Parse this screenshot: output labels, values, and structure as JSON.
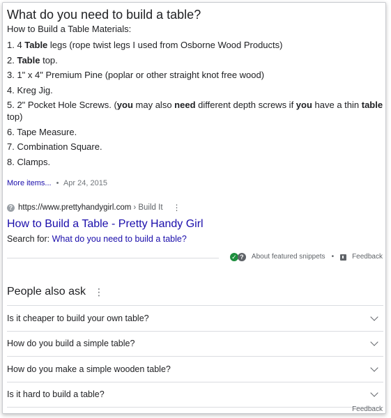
{
  "snippet": {
    "question": "What do you need to build a table?",
    "subheading": "How to Build a Table Materials:",
    "items": [
      [
        {
          "t": "1. 4 "
        },
        {
          "t": "Table",
          "b": true
        },
        {
          "t": " legs (rope twist legs I used from Osborne Wood Products)"
        }
      ],
      [
        {
          "t": "2. "
        },
        {
          "t": "Table",
          "b": true
        },
        {
          "t": " top."
        }
      ],
      [
        {
          "t": "3. 1\" x 4\" Premium Pine (poplar or other straight knot free wood)"
        }
      ],
      [
        {
          "t": "4. Kreg Jig."
        }
      ],
      [
        {
          "t": "5. 2\" Pocket Hole Screws. ("
        },
        {
          "t": "you",
          "b": true
        },
        {
          "t": " may also "
        },
        {
          "t": "need",
          "b": true
        },
        {
          "t": " different depth screws if "
        },
        {
          "t": "you",
          "b": true
        },
        {
          "t": " have a thin "
        },
        {
          "t": "table",
          "b": true
        },
        {
          "t": " top)"
        }
      ],
      [
        {
          "t": "6. Tape Measure."
        }
      ],
      [
        {
          "t": "7. Combination Square."
        }
      ],
      [
        {
          "t": "8. Clamps."
        }
      ]
    ],
    "more_items": "More items...",
    "bullet": "•",
    "date": "Apr 24, 2015"
  },
  "source": {
    "site_icon_glyph": "?",
    "url": "https://www.prettyhandygirl.com",
    "breadcrumb": "› Build It",
    "menu_glyph": "⋮",
    "title": "How to Build a Table - Pretty Handy Girl",
    "search_for_label": "Search for: ",
    "search_for_query": "What do you need to build a table?"
  },
  "featured": {
    "about": "About featured snippets",
    "separator": "•",
    "feedback": "Feedback"
  },
  "paa": {
    "title": "People also ask",
    "menu_glyph": "⋮",
    "questions": [
      "Is it cheaper to build your own table?",
      "How do you build a simple table?",
      "How do you make a simple wooden table?",
      "Is it hard to build a table?"
    ],
    "feedback": "Feedback"
  },
  "colors": {
    "link": "#1a0dab",
    "text": "#202124",
    "muted": "#5f6368",
    "divider": "#dadce0",
    "verified_green": "#1e8e3e"
  },
  "icons": [
    "info-icon",
    "kebab-menu-icon",
    "verified-shield-icon",
    "help-icon",
    "feedback-icon",
    "chevron-down-icon"
  ]
}
